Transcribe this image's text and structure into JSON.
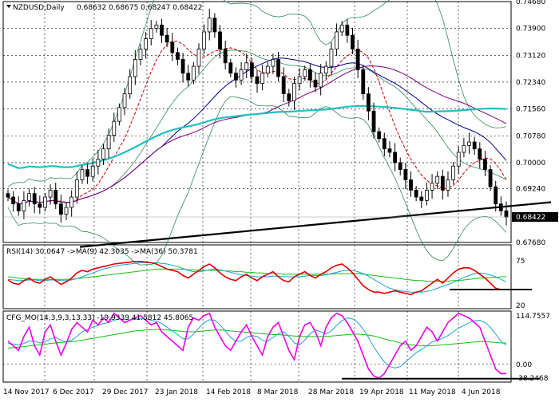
{
  "chart_data": [
    {
      "id": "price",
      "type": "candlestick",
      "symbol_label": "NZDUSD,Daily",
      "ohlc_label": "0.68632 0.68675 0.68247 0.68422",
      "ylim": [
        0.6768,
        0.7468
      ],
      "y_ticks": [
        "0.74680",
        "0.73900",
        "0.73120",
        "0.72340",
        "0.71560",
        "0.70780",
        "0.70000",
        "0.69240",
        "0.67680"
      ],
      "last_price_label": "0.68422",
      "last_price": 0.68422,
      "x_labels": [
        "14 Nov 2017",
        "6 Dec 2017",
        "29 Dec 2017",
        "23 Jan 2018",
        "14 Feb 2018",
        "8 Mar 2018",
        "28 Mar 2018",
        "19 Apr 2018",
        "11 May 2018",
        "4 Jun 2018"
      ],
      "close_series": [
        0.69,
        0.688,
        0.686,
        0.689,
        0.691,
        0.688,
        0.687,
        0.69,
        0.692,
        0.688,
        0.685,
        0.687,
        0.69,
        0.695,
        0.698,
        0.696,
        0.699,
        0.701,
        0.704,
        0.708,
        0.712,
        0.716,
        0.72,
        0.725,
        0.73,
        0.733,
        0.736,
        0.739,
        0.74,
        0.737,
        0.735,
        0.732,
        0.73,
        0.726,
        0.724,
        0.728,
        0.733,
        0.738,
        0.742,
        0.738,
        0.733,
        0.729,
        0.726,
        0.724,
        0.727,
        0.729,
        0.725,
        0.723,
        0.726,
        0.728,
        0.73,
        0.725,
        0.72,
        0.718,
        0.723,
        0.725,
        0.727,
        0.724,
        0.722,
        0.726,
        0.728,
        0.733,
        0.738,
        0.74,
        0.737,
        0.733,
        0.727,
        0.72,
        0.715,
        0.709,
        0.707,
        0.704,
        0.703,
        0.7,
        0.698,
        0.695,
        0.692,
        0.69,
        0.689,
        0.692,
        0.694,
        0.696,
        0.692,
        0.695,
        0.699,
        0.703,
        0.705,
        0.706,
        0.704,
        0.701,
        0.698,
        0.693,
        0.688,
        0.686,
        0.6842
      ],
      "trendline": {
        "from": 0.6755,
        "to": 0.6885
      }
    },
    {
      "id": "rsi",
      "type": "line",
      "label": "RSI(14) 30.0647 ->MA(9) 42.3035 ->MA(36) 50.3781",
      "ylim": [
        0,
        100
      ],
      "y_ticks": [
        "75",
        "20"
      ],
      "series": [
        {
          "values": [
            45,
            40,
            38,
            44,
            48,
            42,
            40,
            46,
            50,
            44,
            38,
            42,
            48,
            56,
            60,
            58,
            62,
            64,
            66,
            68,
            70,
            71,
            72,
            73,
            74,
            74,
            73,
            72,
            70,
            66,
            62,
            60,
            58,
            52,
            48,
            54,
            60,
            66,
            70,
            64,
            56,
            50,
            46,
            44,
            50,
            54,
            48,
            44,
            50,
            54,
            58,
            50,
            44,
            42,
            50,
            54,
            58,
            52,
            48,
            54,
            58,
            64,
            68,
            70,
            64,
            56,
            46,
            36,
            30,
            26,
            26,
            24,
            26,
            28,
            26,
            24,
            22,
            26,
            28,
            34,
            40,
            46,
            40,
            48,
            56,
            62,
            64,
            64,
            60,
            54,
            48,
            40,
            32,
            30,
            30
          ]
        },
        {
          "values": [
            46,
            45,
            44,
            44,
            45,
            45,
            44,
            44,
            45,
            45,
            44,
            44,
            45,
            47,
            50,
            53,
            56,
            59,
            62,
            64,
            66,
            68,
            69,
            70,
            71,
            72,
            72,
            72,
            72,
            71,
            70,
            68,
            66,
            63,
            60,
            58,
            58,
            59,
            61,
            62,
            61,
            59,
            57,
            55,
            53,
            52,
            51,
            50,
            50,
            50,
            51,
            51,
            50,
            50,
            50,
            50,
            51,
            52,
            52,
            52,
            53,
            55,
            57,
            59,
            60,
            60,
            58,
            55,
            51,
            46,
            41,
            36,
            32,
            30,
            28,
            27,
            26,
            26,
            26,
            27,
            29,
            32,
            35,
            38,
            41,
            45,
            49,
            52,
            55,
            56,
            55,
            53,
            50,
            46,
            42
          ]
        },
        {
          "values": [
            50,
            49,
            48,
            47,
            46,
            46,
            46,
            46,
            46,
            46,
            46,
            46,
            46,
            47,
            48,
            49,
            50,
            51,
            52,
            53,
            54,
            55,
            56,
            57,
            58,
            59,
            60,
            61,
            62,
            62,
            62,
            62,
            62,
            62,
            61,
            61,
            60,
            60,
            60,
            60,
            60,
            59,
            59,
            58,
            58,
            57,
            57,
            56,
            56,
            55,
            55,
            55,
            54,
            54,
            54,
            54,
            54,
            54,
            54,
            54,
            54,
            54,
            55,
            55,
            55,
            55,
            55,
            54,
            53,
            52,
            51,
            50,
            49,
            48,
            47,
            46,
            45,
            44,
            44,
            43,
            43,
            43,
            43,
            43,
            44,
            44,
            45,
            46,
            47,
            48,
            48,
            49,
            49,
            50,
            50
          ]
        }
      ],
      "reference_value": 20
    },
    {
      "id": "cfg_mo",
      "type": "line",
      "label": "CFG_MO(14,3,9,3,13,33) -19.9339 41.5812 45.8065",
      "ylim": [
        -38.2468,
        114.7557
      ],
      "y_ticks": [
        "114.7557",
        "0.00",
        "-38.2468"
      ],
      "series": [
        {
          "values": [
            50,
            40,
            30,
            60,
            80,
            40,
            20,
            70,
            85,
            50,
            20,
            45,
            75,
            90,
            80,
            70,
            95,
            85,
            100,
            90,
            110,
            100,
            90,
            95,
            100,
            105,
            95,
            85,
            90,
            70,
            60,
            50,
            40,
            30,
            80,
            100,
            95,
            105,
            110,
            80,
            60,
            40,
            30,
            50,
            70,
            85,
            60,
            40,
            20,
            60,
            80,
            90,
            60,
            30,
            10,
            60,
            85,
            90,
            70,
            40,
            80,
            100,
            110,
            105,
            90,
            70,
            50,
            20,
            -10,
            -25,
            -30,
            -20,
            0,
            20,
            40,
            50,
            30,
            40,
            60,
            80,
            70,
            50,
            70,
            90,
            100,
            110,
            105,
            100,
            90,
            80,
            50,
            20,
            -10,
            -20,
            -19.9
          ]
        },
        {
          "values": [
            45,
            44,
            42,
            45,
            50,
            50,
            46,
            48,
            55,
            58,
            52,
            48,
            52,
            60,
            70,
            75,
            80,
            84,
            88,
            90,
            95,
            98,
            97,
            96,
            97,
            99,
            98,
            95,
            93,
            88,
            80,
            72,
            64,
            55,
            55,
            65,
            78,
            90,
            96,
            95,
            85,
            72,
            58,
            50,
            50,
            58,
            62,
            60,
            52,
            50,
            58,
            66,
            70,
            60,
            46,
            42,
            52,
            66,
            74,
            70,
            65,
            72,
            84,
            94,
            100,
            98,
            90,
            76,
            58,
            38,
            20,
            5,
            -5,
            -8,
            -5,
            5,
            15,
            25,
            32,
            40,
            48,
            52,
            56,
            62,
            70,
            78,
            84,
            90,
            94,
            95,
            90,
            80,
            65,
            50,
            41.6
          ]
        },
        {
          "values": [
            35,
            36,
            37,
            38,
            40,
            41,
            42,
            43,
            45,
            46,
            47,
            48,
            49,
            50,
            52,
            54,
            56,
            58,
            60,
            62,
            64,
            66,
            68,
            70,
            72,
            73,
            74,
            75,
            75,
            75,
            74,
            73,
            72,
            71,
            70,
            70,
            71,
            72,
            73,
            74,
            74,
            73,
            72,
            71,
            70,
            69,
            68,
            67,
            66,
            65,
            64,
            64,
            63,
            62,
            61,
            60,
            60,
            60,
            60,
            60,
            60,
            61,
            62,
            63,
            64,
            65,
            65,
            64,
            63,
            61,
            58,
            55,
            52,
            49,
            46,
            44,
            42,
            41,
            40,
            40,
            40,
            41,
            42,
            43,
            44,
            45,
            46,
            47,
            48,
            49,
            49,
            48,
            47,
            46,
            45.8
          ]
        }
      ],
      "reference_value": -31
    }
  ],
  "colors": {
    "bull_candle": "#000000",
    "bear_candle": "#000000",
    "bollinger": "#2e8b57",
    "ma_fast": "#cc0000",
    "ma_mid": "#00008b",
    "ma_slow": "#800080",
    "ma_long": "#20c0c0",
    "rsi_line": "#e00000",
    "rsi_ma9": "#20a0d0",
    "rsi_ma36": "#10c010",
    "cfg_main": "#ee00ee",
    "cfg_sig1": "#20a0d0",
    "cfg_sig2": "#10c010"
  }
}
